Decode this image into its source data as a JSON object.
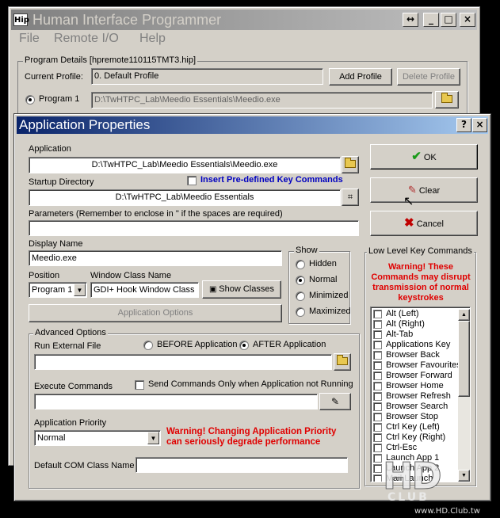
{
  "main_window": {
    "app_icon_text": "Hip",
    "title": "Human Interface Programmer",
    "caption_buttons": [
      "↔",
      "_",
      "□",
      "×"
    ],
    "menu": [
      "File",
      "Remote I/O",
      "Help"
    ],
    "program_details_label": "Program Details [hpremote110115TMT3.hip]",
    "current_profile_label": "Current Profile:",
    "current_profile_value": "0. Default Profile",
    "add_profile": "Add Profile",
    "delete_profile": "Delete Profile",
    "program1_label": "Program 1",
    "program1_path": "D:\\TwHTPC_Lab\\Meedio Essentials\\Meedio.exe"
  },
  "dialog": {
    "title": "Application Properties",
    "help_btn": "?",
    "close_btn": "×",
    "application_label": "Application",
    "application_value": "D:\\TwHTPC_Lab\\Meedio Essentials\\Meedio.exe",
    "insert_predefined_label": "Insert Pre-defined Key Commands",
    "startup_dir_label": "Startup Directory",
    "startup_dir_value": "D:\\TwHTPC_Lab\\Meedio Essentials",
    "parameters_label": "Parameters (Remember to enclose in \" if the spaces are required)",
    "parameters_value": "",
    "display_name_label": "Display Name",
    "display_name_value": "Meedio.exe",
    "position_label": "Position",
    "position_value": "Program 1",
    "window_class_label": "Window Class Name",
    "window_class_value": "GDI+ Hook Window Class",
    "show_classes": "Show Classes",
    "application_options": "Application Options",
    "show_group": {
      "label": "Show",
      "options": [
        "Hidden",
        "Normal",
        "Minimized",
        "Maximized"
      ],
      "selected": "Normal"
    },
    "ok": "OK",
    "clear": "Clear",
    "cancel": "Cancel",
    "low_level": {
      "label": "Low Level Key Commands",
      "warning": "Warning! These Commands may disrupt transmission of normal keystrokes",
      "items": [
        "Alt (Left)",
        "Alt (Right)",
        "Alt-Tab",
        "Applications Key",
        "Browser Back",
        "Browser Favourites",
        "Browser Forward",
        "Browser Home",
        "Browser Refresh",
        "Browser Search",
        "Browser Stop",
        "Ctrl Key (Left)",
        "Ctrl Key (Right)",
        "Ctrl-Esc",
        "Launch App 1",
        "Launch App 2",
        "Mail Launch"
      ]
    },
    "advanced": {
      "label": "Advanced Options",
      "run_external_label": "Run External File",
      "before_app": "BEFORE Application",
      "after_app": "AFTER Application",
      "run_external_value": "",
      "execute_commands_label": "Execute Commands",
      "send_only_label": "Send Commands Only when Application not Running",
      "execute_commands_value": "",
      "priority_label": "Application Priority",
      "priority_value": "Normal",
      "priority_warning": "Warning! Changing Application Priority can seriously degrade performance",
      "com_class_label": "Default COM Class Name",
      "com_class_value": ""
    }
  },
  "watermark": {
    "big": "HD",
    "small": "CLUB",
    "url": "www.HD.Club.tw"
  },
  "colors": {
    "face": "#d4d0c8",
    "title_active_start": "#0a246a",
    "title_active_end": "#a6caf0",
    "warning": "#e00000",
    "link_blue": "#0000c0"
  }
}
